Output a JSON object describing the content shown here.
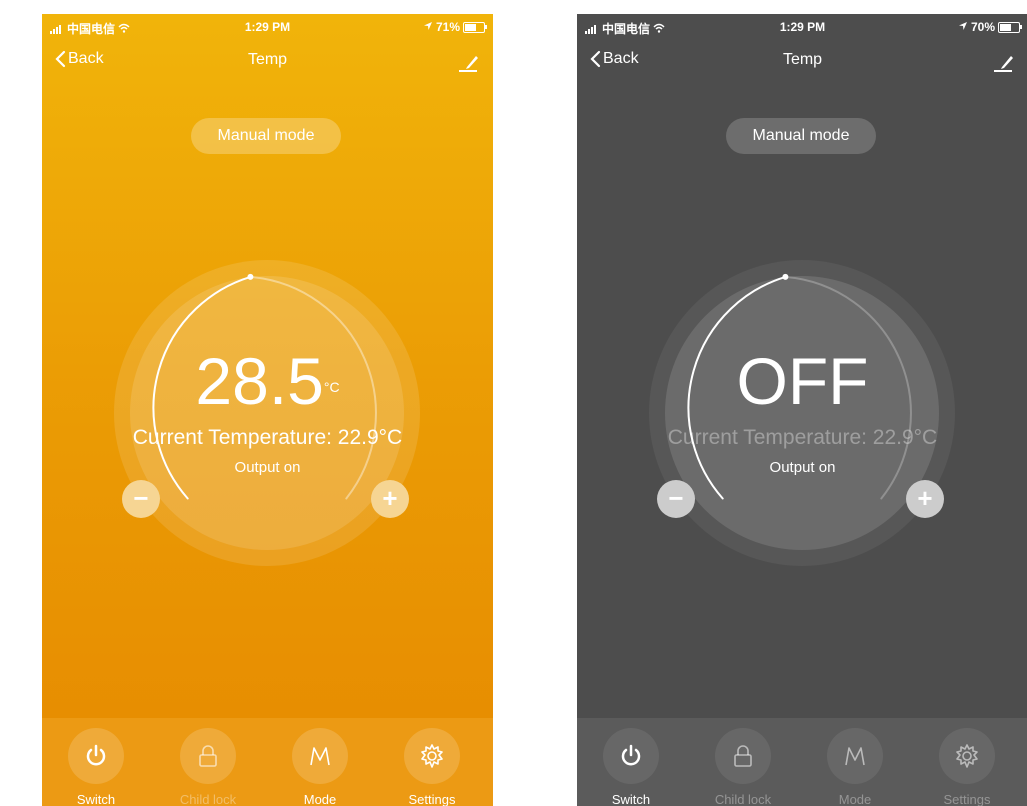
{
  "screens": [
    {
      "status": {
        "carrier": "中国电信",
        "time": "1:29 PM",
        "battery": "71%",
        "battery_level": 0.71
      },
      "nav": {
        "back": "Back",
        "title": "Temp"
      },
      "mode": "Manual mode",
      "display": {
        "value": "28.5",
        "unit": "°C"
      },
      "current_temperature": "Current Temperature: 22.9°C",
      "output_status": "Output on",
      "tabs": [
        "Switch",
        "Child lock",
        "Mode",
        "Settings"
      ]
    },
    {
      "status": {
        "carrier": "中国电信",
        "time": "1:29 PM",
        "battery": "70%",
        "battery_level": 0.7
      },
      "nav": {
        "back": "Back",
        "title": "Temp"
      },
      "mode": "Manual mode",
      "display": {
        "value": "OFF"
      },
      "current_temperature": "Current Temperature: 22.9°C",
      "output_status": "Output on",
      "tabs": [
        "Switch",
        "Child lock",
        "Mode",
        "Settings"
      ]
    }
  ],
  "colors": {
    "orange": "#eb9d05",
    "gray": "#4d4d4d"
  }
}
